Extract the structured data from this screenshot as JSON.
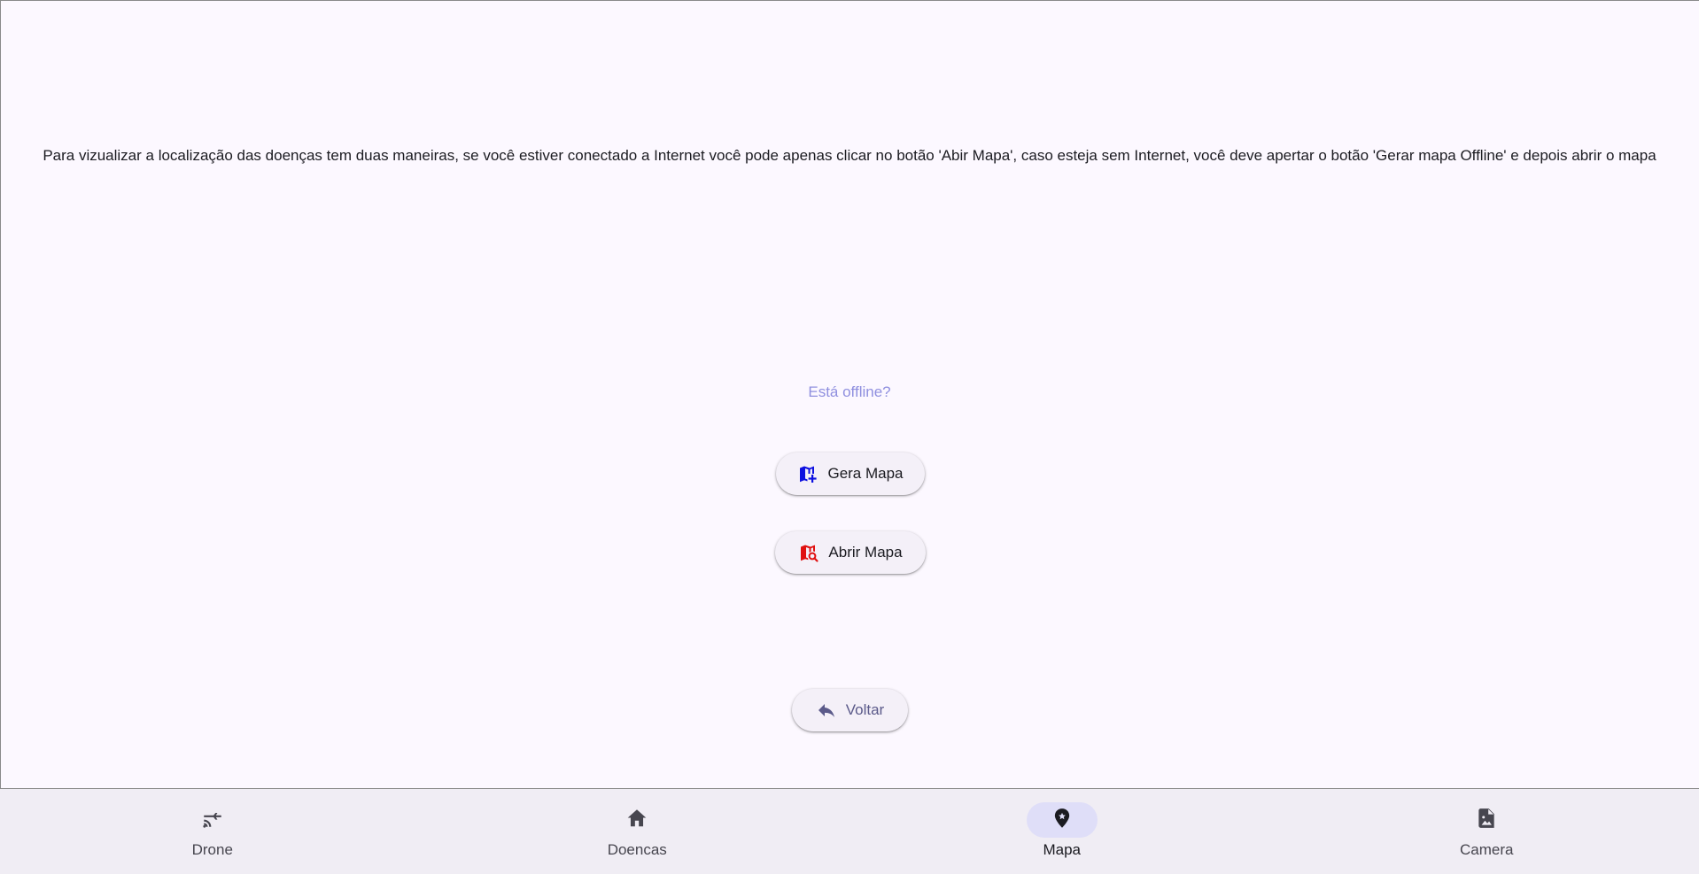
{
  "main": {
    "instruction": "Para vizualizar a localização das doenças tem duas maneiras, se você estiver conectado a Internet você pode apenas clicar no botão 'Abir Mapa', caso esteja sem Internet, você deve apertar o botão 'Gerar mapa Offline' e depois abrir o mapa",
    "offline_label": "Está offline?",
    "gera_mapa": {
      "label": "Gera Mapa",
      "icon": "map-add-icon",
      "icon_color": "#0d10e0"
    },
    "abrir_mapa": {
      "label": "Abrir Mapa",
      "icon": "map-search-icon",
      "icon_color": "#e01010"
    },
    "voltar": {
      "label": "Voltar",
      "icon": "reply-arrow-icon"
    }
  },
  "nav": {
    "items": [
      {
        "label": "Drone",
        "icon": "drone-flight-icon",
        "active": false
      },
      {
        "label": "Doencas",
        "icon": "home-icon",
        "active": false
      },
      {
        "label": "Mapa",
        "icon": "map-pin-icon",
        "active": true
      },
      {
        "label": "Camera",
        "icon": "image-file-icon",
        "active": false
      }
    ]
  },
  "colors": {
    "background": "#fcf8ff",
    "nav_background": "#f0edf4",
    "active_indicator": "#dfdef8",
    "offline_text": "#8f8fdf"
  }
}
